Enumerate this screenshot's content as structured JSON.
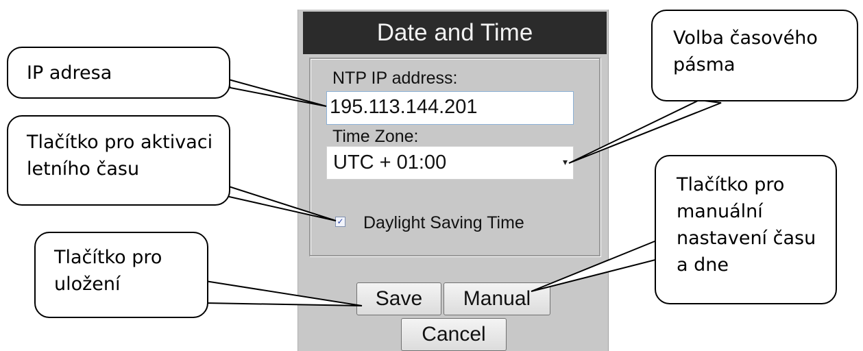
{
  "dialog": {
    "title": "Date and Time",
    "ntp_label": "NTP IP address:",
    "ntp_value": "195.113.144.201",
    "tz_label": "Time Zone:",
    "tz_value": "UTC + 01:00",
    "dst_checked": true,
    "dst_label": "Daylight Saving Time",
    "save_label": "Save",
    "manual_label": "Manual",
    "cancel_label": "Cancel"
  },
  "callouts": {
    "ip": "IP adresa",
    "dst_line1": "Tlačítko pro aktivaci",
    "dst_line2": "letního času",
    "save_line1": "Tlačítko pro",
    "save_line2": "uložení",
    "tz_line1": "Volba časového",
    "tz_line2": "pásma",
    "manual_line1": "Tlačítko pro",
    "manual_line2": "manuální",
    "manual_line3": "nastavení času",
    "manual_line4": "a dne"
  }
}
